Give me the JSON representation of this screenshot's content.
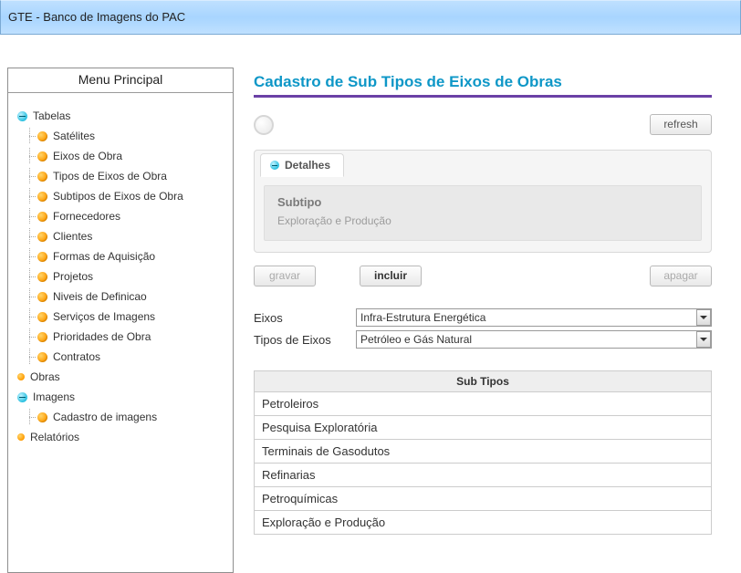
{
  "app_title": "GTE - Banco de Imagens do PAC",
  "sidebar": {
    "title": "Menu Principal",
    "tabelas": {
      "label": "Tabelas",
      "items": [
        "Satélites",
        "Eixos de Obra",
        "Tipos de Eixos de Obra",
        "Subtipos de Eixos de Obra",
        "Fornecedores",
        "Clientes",
        "Formas de Aquisição",
        "Projetos",
        "Niveis de Definicao",
        "Serviços de Imagens",
        "Prioridades de Obra",
        "Contratos"
      ]
    },
    "obras": {
      "label": "Obras"
    },
    "imagens": {
      "label": "Imagens",
      "items": [
        "Cadastro de imagens"
      ]
    },
    "relatorios": {
      "label": "Relatórios"
    }
  },
  "page": {
    "title": "Cadastro de Sub Tipos de Eixos de Obras",
    "refresh_label": "refresh",
    "tab_label": "Detalhes",
    "field_label": "Subtipo",
    "field_value": "Exploração e Produção",
    "buttons": {
      "gravar": "gravar",
      "incluir": "incluir",
      "apagar": "apagar"
    },
    "selects": {
      "eixos_label": "Eixos",
      "eixos_value": "Infra-Estrutura Energética",
      "tipos_label": "Tipos de Eixos",
      "tipos_value": "Petróleo e Gás Natural"
    },
    "table": {
      "header": "Sub Tipos",
      "rows": [
        "Petroleiros",
        "Pesquisa Exploratória",
        "Terminais de Gasodutos",
        "Refinarias",
        "Petroquímicas",
        "Exploração e Produção"
      ]
    }
  }
}
